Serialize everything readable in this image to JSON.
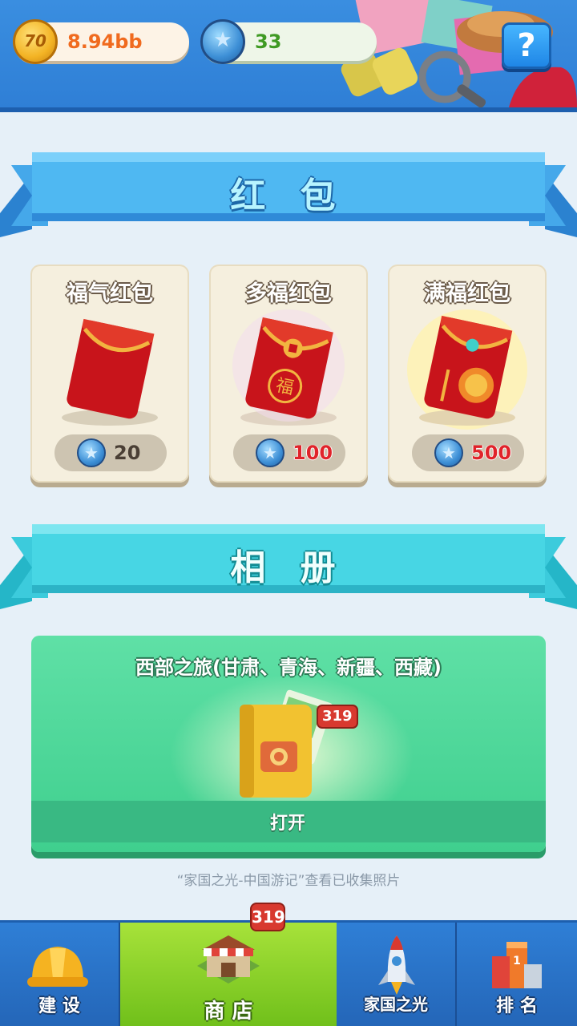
{
  "header": {
    "coins": {
      "icon": "coin-icon",
      "icon_text": "70",
      "value": "8.94bb"
    },
    "gems": {
      "icon": "star-gem-icon",
      "value": "33"
    },
    "help_label": "?"
  },
  "red_envelopes": {
    "title": "红 包",
    "items": [
      {
        "name": "福气红包",
        "price": "20",
        "price_color": "#4a3f35"
      },
      {
        "name": "多福红包",
        "price": "100",
        "price_color": "#e0232a"
      },
      {
        "name": "满福红包",
        "price": "500",
        "price_color": "#e0232a"
      }
    ]
  },
  "album": {
    "section_title": "相 册",
    "card_title": "西部之旅(甘肃、青海、新疆、西藏)",
    "badge_count": "319",
    "open_label": "打开",
    "hint": "“家国之光-中国游记”查看已收集照片"
  },
  "bottom_nav": {
    "items": [
      {
        "label": "建 设",
        "icon": "hard-hat-icon"
      },
      {
        "label": "商 店",
        "icon": "shop-icon",
        "active": true
      },
      {
        "label": "家国之光",
        "icon": "rocket-icon"
      },
      {
        "label": "排 名",
        "icon": "ranking-icon"
      }
    ],
    "shop_badge": "319"
  }
}
